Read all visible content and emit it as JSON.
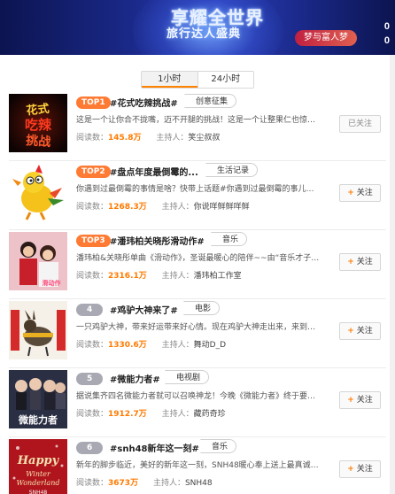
{
  "banner": {
    "title": "享耀全世界",
    "subtitle": "旅行达人盛典",
    "tag": "",
    "pill": "梦与富人梦",
    "num_top": "0",
    "num_bottom": "0"
  },
  "tabs": [
    {
      "label": "1小时",
      "active": true
    },
    {
      "label": "24小时",
      "active": false
    }
  ],
  "labels": {
    "reads": "阅读数：",
    "host": "主持人：",
    "follow": "关注",
    "followed": "已关注"
  },
  "items": [
    {
      "rank": "TOP1",
      "title": "#花式吃辣挑战#",
      "category": "创意征集",
      "desc": "这是一个让你合不拢嘴，迈不开腿的挑战！这是一个让整果仁也惊奇的中...",
      "reads": "145.8万",
      "host": "笑尘叔叔",
      "followed": true,
      "thumb_text": "花式吃辣挑战"
    },
    {
      "rank": "TOP2",
      "title": "#盘点年度最倒霉的...",
      "category": "生活记录",
      "desc": "你遇到过最倒霉的事情是啥？快带上话题#你遇到过最倒霉的事儿#一起参...",
      "reads": "1268.3万",
      "host": "你说咩鲜鲜咩鲜",
      "followed": false,
      "thumb_text": ""
    },
    {
      "rank": "TOP3",
      "title": "#潘玮柏关晓彤滑动作#",
      "category": "音乐",
      "desc": "潘玮柏&关晓彤单曲《滑动作》，圣诞最暖心的陪伴~~由“音乐才子”潘...",
      "reads": "2316.1万",
      "host": "潘玮柏工作室",
      "followed": false,
      "thumb_text": "关晓彤"
    },
    {
      "rank": "4",
      "title": "#鸡驴大神来了#",
      "category": "电影",
      "desc": "一只鸡驴大神，带来好运带来好心情。现在鸡驴大神走出来，来到你面前...",
      "reads": "1330.6万",
      "host": "舞动D_D",
      "followed": false,
      "thumb_text": ""
    },
    {
      "rank": "5",
      "title": "#微能力者#",
      "category": "电视剧",
      "desc": "据说集齐四名微能力者就可以召唤神龙！今晚《微能力者》终于要大结局...",
      "reads": "1912.7万",
      "host": "藏药奇珍",
      "followed": false,
      "thumb_text": "微能力者"
    },
    {
      "rank": "6",
      "title": "#snh48新年这一刻#",
      "category": "音乐",
      "desc": "新年的脚步临近，美好的新年这一刻，SNH48暖心奉上送上最真诚的祝福，...",
      "reads": "3673万",
      "host": "SNH48",
      "followed": false,
      "thumb_text": "Happy Winter Wonderland"
    }
  ],
  "colors": {
    "accent": "#ff7a00",
    "rank_hot": "#ff7a33",
    "rank_normal": "#a9a9b3"
  }
}
